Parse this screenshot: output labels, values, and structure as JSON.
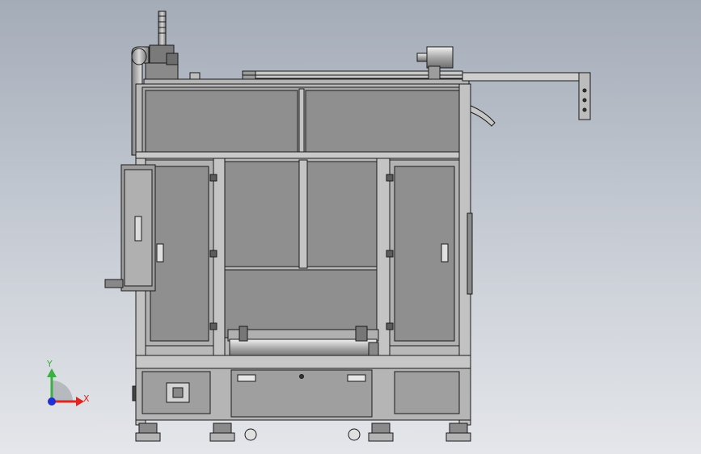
{
  "view": {
    "background_top": "#a4acb8",
    "background_bottom": "#e4e6ea",
    "model_fill": "#9a9a9a",
    "panel_fill": "#8f8f8f",
    "frame_fill": "#b9b9b9",
    "edge_color": "#1a1a1a"
  },
  "triad": {
    "x_label": "X",
    "y_label": "Y",
    "x_color": "#e0241f",
    "y_color": "#3cb043",
    "z_color": "#1e2fd6"
  }
}
